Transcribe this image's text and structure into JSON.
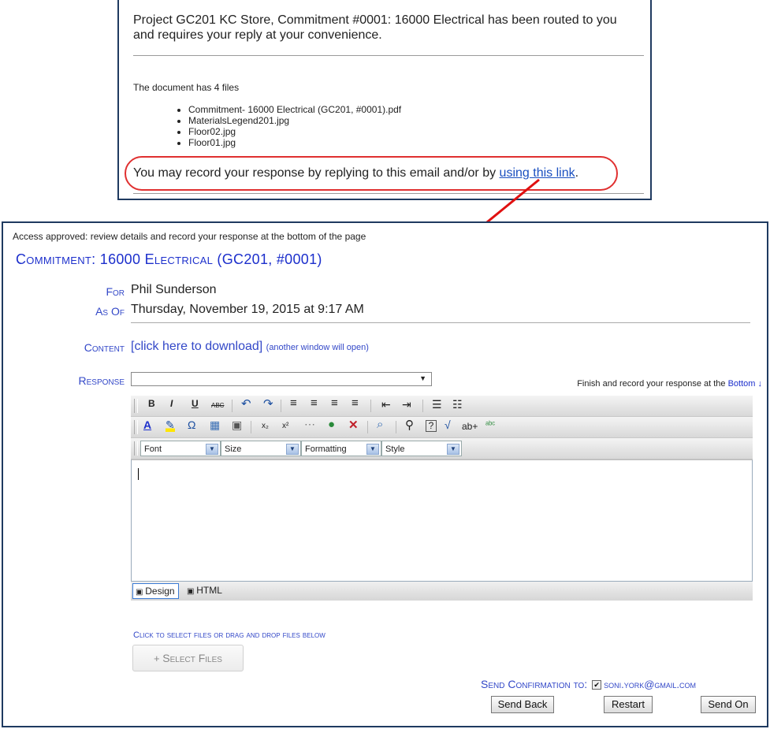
{
  "email": {
    "message_line1": "Project GC201 KC Store, Commitment #0001: 16000 Electrical has been routed to you",
    "message_line2": "and requires your reply at your convenience.",
    "file_count": "The document has 4 files",
    "files": [
      "Commitment- 16000 Electrical (GC201, #0001).pdf",
      "MaterialsLegend201.jpg",
      "Floor02.jpg",
      "Floor01.jpg"
    ],
    "response_text": "You may record your response by replying to this email and/or by ",
    "response_link": "using this link",
    "response_end": "."
  },
  "form": {
    "access_note": "Access approved: review details and record your response at the bottom of the page",
    "title": "Commitment: 16000 Electrical (GC201, #0001)",
    "for_label": "For",
    "for_value": "Phil Sunderson",
    "asof_label": "As Of",
    "asof_value": "Thursday, November 19, 2015 at 9:17 AM",
    "content_label": "Content",
    "content_link": "[click here to download]",
    "content_note": "(another window will open)",
    "response_label": "Response",
    "response_value": "",
    "finish_text": "Finish and record your response at the ",
    "finish_link": "Bottom ↓"
  },
  "editor": {
    "row1": [
      "B",
      "I",
      "U",
      "ABC",
      "↶",
      "↷",
      "≡",
      "≡",
      "≡",
      "≡",
      "⇤",
      "⇥",
      "☰",
      "☷"
    ],
    "row2": [
      "A",
      "✎",
      "Ω",
      "▦",
      "▣",
      "x₂",
      "x²",
      "⋯",
      "●",
      "✕",
      "⌕",
      "⚲",
      "?",
      "√",
      "ab+",
      "ᵃᵇᶜ"
    ],
    "dropdowns": [
      "Font",
      "Size",
      "Formatting",
      "Style"
    ],
    "modes": [
      "Design",
      "HTML"
    ],
    "content": ""
  },
  "upload": {
    "hint": "Click to select files or drag and drop files below",
    "button": "Select Files"
  },
  "confirm": {
    "label": "Send Confirmation to:",
    "email": "soni.york@gmail.com",
    "checked": true
  },
  "buttons": {
    "send_back": "Send Back",
    "restart": "Restart",
    "send_on": "Send On"
  },
  "colors": {
    "label_blue": "#3348c8",
    "title_blue": "#1c2fcc",
    "highlight_red": "#e03030",
    "frame_navy": "#1f3a60"
  }
}
